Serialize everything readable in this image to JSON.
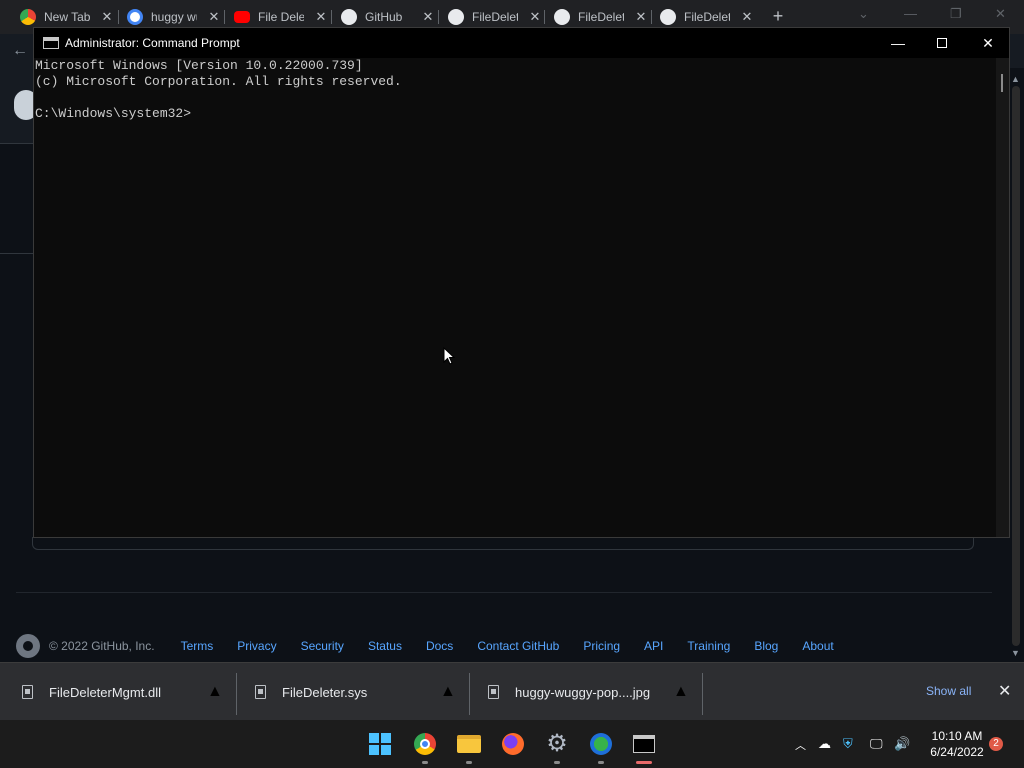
{
  "browser": {
    "tabs": [
      {
        "label": "New Tab",
        "icon": "chrome-icon"
      },
      {
        "label": "huggy wuggy",
        "icon": "google-icon"
      },
      {
        "label": "File Deleter",
        "icon": "youtube-icon"
      },
      {
        "label": "GitHub",
        "icon": "github-icon"
      },
      {
        "label": "FileDeleter",
        "icon": "github-icon"
      },
      {
        "label": "FileDeleter",
        "icon": "github-icon"
      },
      {
        "label": "FileDeleter",
        "icon": "github-icon"
      }
    ],
    "new_tab_symbol": "+"
  },
  "cmd": {
    "title": "Administrator: Command Prompt",
    "lines": [
      "Microsoft Windows [Version 10.0.22000.739]",
      "(c) Microsoft Corporation. All rights reserved.",
      "",
      "C:\\Windows\\system32>"
    ]
  },
  "footer": {
    "copyright": "© 2022 GitHub, Inc.",
    "links": [
      "Terms",
      "Privacy",
      "Security",
      "Status",
      "Docs",
      "Contact GitHub",
      "Pricing",
      "API",
      "Training",
      "Blog",
      "About"
    ]
  },
  "downloads": {
    "items": [
      "FileDeleterMgmt.dll",
      "FileDeleter.sys",
      "huggy-wuggy-pop....jpg"
    ],
    "show_all": "Show all"
  },
  "taskbar": {
    "time": "10:10 AM",
    "date": "6/24/2022",
    "notification_count": "2"
  },
  "colors": {
    "console_bg": "#0c0c0c",
    "console_text": "#cccccc",
    "link": "#58a6ff",
    "download_link": "#8ab4f8"
  }
}
